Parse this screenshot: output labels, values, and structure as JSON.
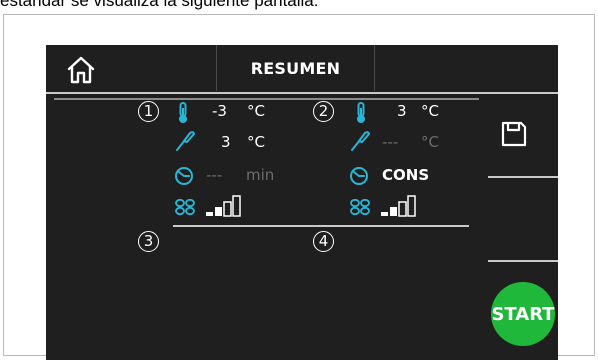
{
  "caption": "estándar se visualiza la siguiente pantalla:",
  "header": {
    "title": "RESUMEN",
    "home_icon": "home-icon"
  },
  "zones": {
    "z1": {
      "number": "1",
      "temp_value": "-3",
      "temp_unit": "°C",
      "probe_value": "3",
      "probe_unit": "°C",
      "timer_value": "---",
      "timer_unit": "min",
      "fan_level": 2
    },
    "z2": {
      "number": "2",
      "temp_value": "3",
      "temp_unit": "°C",
      "probe_value": "---",
      "probe_unit": "°C",
      "timer_value": "CONS",
      "fan_level": 2
    },
    "z3": {
      "number": "3"
    },
    "z4": {
      "number": "4"
    }
  },
  "side": {
    "save_icon": "save-icon",
    "start_label": "START"
  },
  "colors": {
    "background": "#1f1f1f",
    "accent": "#29b6d6",
    "start": "#1fb83a",
    "text": "#ffffff",
    "dim": "#6d6d6d"
  }
}
